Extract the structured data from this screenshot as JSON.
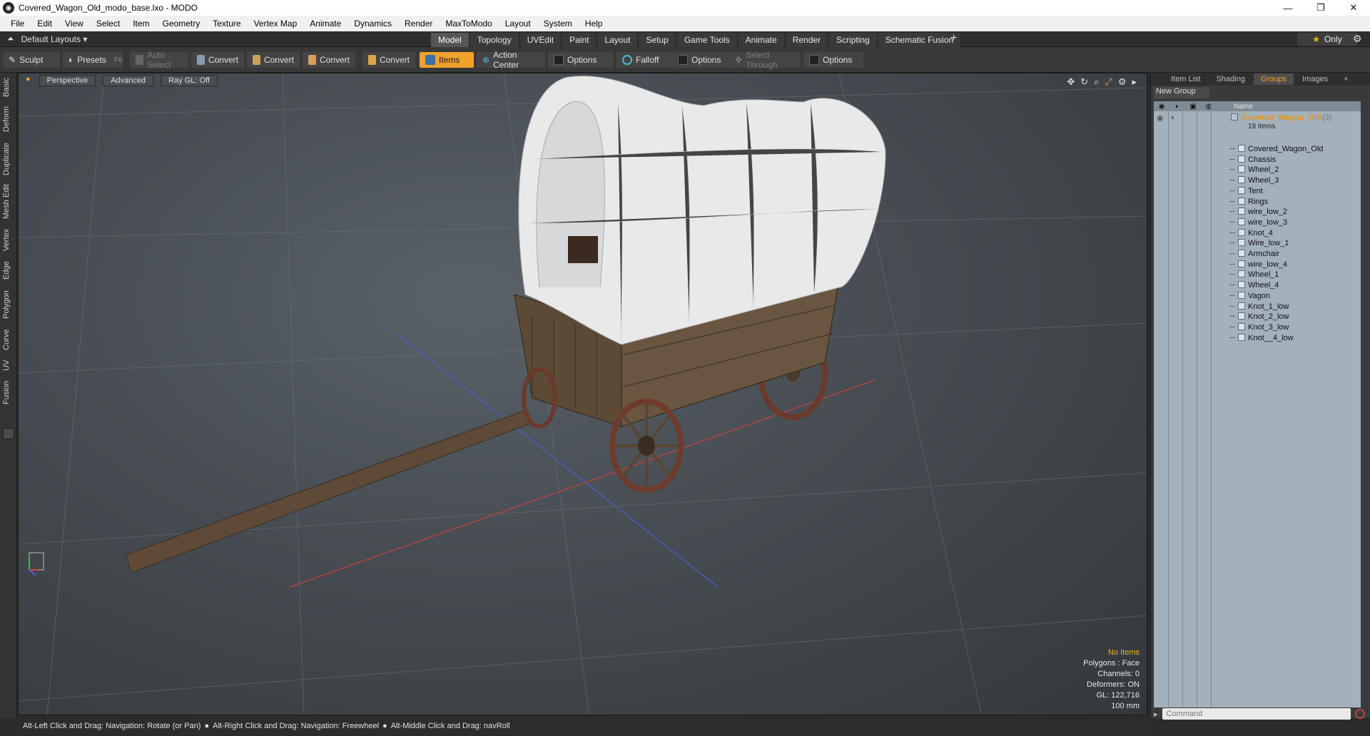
{
  "window": {
    "title": "Covered_Wagon_Old_modo_base.lxo - MODO",
    "controls": [
      "—",
      "❐",
      "✕"
    ]
  },
  "menu": [
    "File",
    "Edit",
    "View",
    "Select",
    "Item",
    "Geometry",
    "Texture",
    "Vertex Map",
    "Animate",
    "Dynamics",
    "Render",
    "MaxToModo",
    "Layout",
    "System",
    "Help"
  ],
  "layoutbar": {
    "layout_name": "Default Layouts ▾",
    "tabs": [
      "Model",
      "Topology",
      "UVEdit",
      "Paint",
      "Layout",
      "Setup",
      "Game Tools",
      "Animate",
      "Render",
      "Scripting",
      "Schematic Fusion"
    ],
    "active_tab": "Model",
    "plus": "+",
    "only_label": "Only"
  },
  "toolbar": {
    "sculpt": "Sculpt",
    "presets": "Presets",
    "presets_key": "F6",
    "auto_select": "Auto Select",
    "convert1": "Convert",
    "convert2": "Convert",
    "convert3": "Convert",
    "convert4": "Convert",
    "items": "Items",
    "action_center": "Action Center",
    "options1": "Options",
    "falloff": "Falloff",
    "options2": "Options",
    "select_through": "Select Through",
    "options3": "Options"
  },
  "left_tabs": [
    "Basic",
    "Deform",
    "Duplicate",
    "Mesh Edit",
    "Vertex",
    "Edge",
    "Polygon",
    "Curve",
    "UV",
    "Fusion"
  ],
  "viewport": {
    "view": "Perspective",
    "advanced": "Advanced",
    "raygl": "Ray GL: Off",
    "stats": {
      "no_items": "No Items",
      "polygons": "Polygons : Face",
      "channels": "Channels: 0",
      "deformers": "Deformers: ON",
      "gl": "GL: 122,716",
      "scale": "100 mm"
    }
  },
  "right_panel": {
    "tabs": [
      "Item List",
      "Shading",
      "Groups",
      "Images",
      "+"
    ],
    "active_tab": "Groups",
    "new_group": "New Group",
    "column_name": "Name",
    "group": {
      "name": "Covered_Wagon_Old",
      "count": "(3)",
      "sub": "19 Items"
    },
    "items": [
      "Covered_Wagon_Old",
      "Chassis",
      "Wheel_2",
      "Wheel_3",
      "Tent",
      "Rings",
      "wire_low_2",
      "wire_low_3",
      "Knot_4",
      "Wire_low_1",
      "Armchair",
      "wire_low_4",
      "Wheel_1",
      "Wheel_4",
      "Vagon",
      "Knot_1_low",
      "Knot_2_low",
      "Knot_3_low",
      "Knot__4_low"
    ],
    "command_placeholder": "Command"
  },
  "statusbar": {
    "hint1": "Alt-Left Click and Drag: Navigation: Rotate (or Pan)",
    "hint2": "Alt-Right Click and Drag: Navigation: Freewheel",
    "hint3": "Alt-Middle Click and Drag: navRoll"
  },
  "colors": {
    "accent": "#f0a12c",
    "group_name": "#e8941a",
    "list_bg": "#a3b1bd"
  }
}
